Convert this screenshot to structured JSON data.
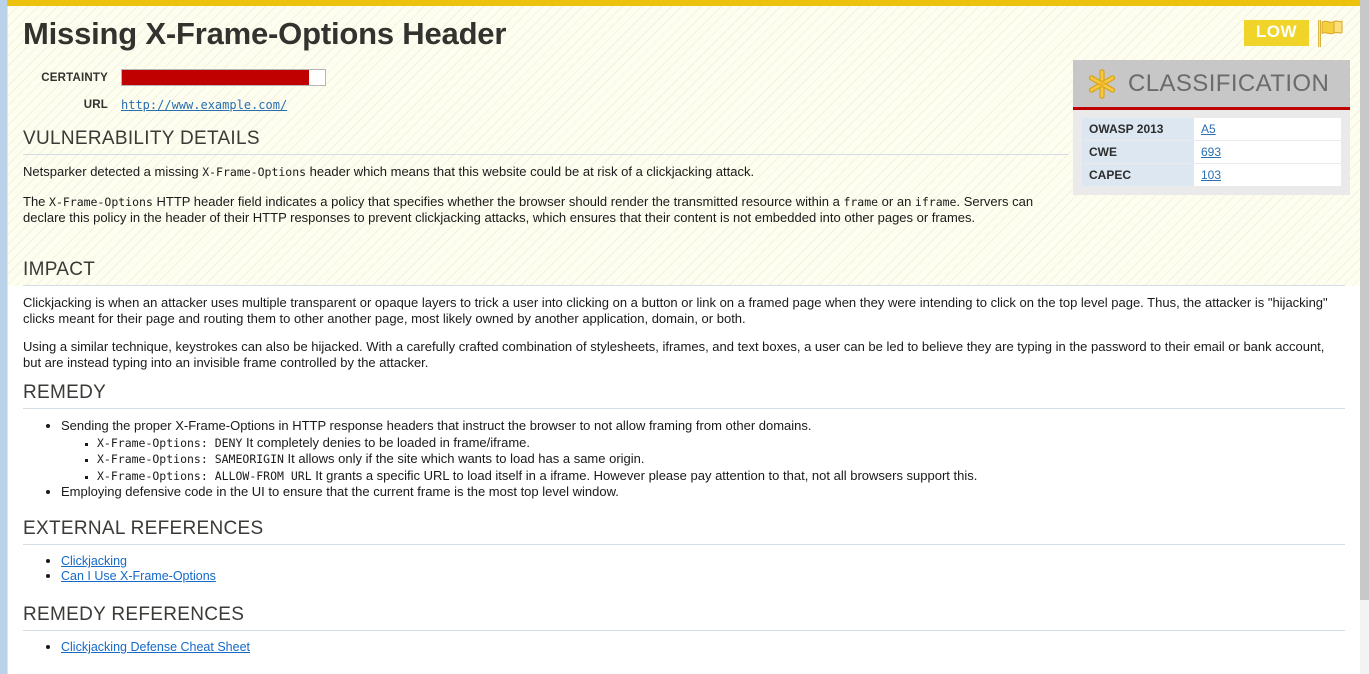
{
  "report": {
    "title": "Missing X-Frame-Options Header",
    "severity_badge": "LOW",
    "severity_color": "#f0d429",
    "flag_icon": "flag-icon"
  },
  "meta": {
    "certainty_label": "CERTAINTY",
    "certainty_percent": 92,
    "certainty_bar_color": "#c00000",
    "url_label": "URL",
    "url_value": "http://www.example.com/"
  },
  "classification": {
    "icon": "asterisk-star-icon",
    "heading": "CLASSIFICATION",
    "accent_color": "#c00000",
    "rows": [
      {
        "key": "OWASP 2013",
        "value": "A5"
      },
      {
        "key": "CWE",
        "value": "693"
      },
      {
        "key": "CAPEC",
        "value": "103"
      }
    ]
  },
  "sections": {
    "vulnerability_details": {
      "heading": "VULNERABILITY DETAILS",
      "p1_a": "Netsparker detected a missing ",
      "p1_code": "X-Frame-Options",
      "p1_b": " header which means that this website could be at risk of a clickjacking attack.",
      "p2_a": "The ",
      "p2_code1": "X-Frame-Options",
      "p2_b": " HTTP header field indicates a policy that specifies whether the browser should render the transmitted resource within a ",
      "p2_code2": "frame",
      "p2_c": " or an ",
      "p2_code3": "iframe",
      "p2_d": ". Servers can declare this policy in the header of their HTTP responses to prevent clickjacking attacks, which ensures that their content is not embedded into other pages or frames."
    },
    "impact": {
      "heading": "IMPACT",
      "p1": "Clickjacking is when an attacker uses multiple transparent or opaque layers to trick a user into clicking on a button or link on a framed page when they were intending to click on the top level page. Thus, the attacker is \"hijacking\" clicks meant for their page and routing them to other another page, most likely owned by another application, domain, or both.",
      "p2": "Using a similar technique, keystrokes can also be hijacked. With a carefully crafted combination of stylesheets, iframes, and text boxes, a user can be led to believe they are typing in the password to their email or bank account, but are instead typing into an invisible frame controlled by the attacker."
    },
    "remedy": {
      "heading": "REMEDY",
      "bullet1": "Sending the proper X-Frame-Options in HTTP response headers that instruct the browser to not allow framing from other domains.",
      "sub1_code": "X-Frame-Options: DENY",
      "sub1_text": " It completely denies to be loaded in frame/iframe.",
      "sub2_code": "X-Frame-Options: SAMEORIGIN",
      "sub2_text": " It allows only if the site which wants to load has a same origin.",
      "sub3_code": "X-Frame-Options: ALLOW-FROM URL",
      "sub3_text": " It grants a specific URL to load itself in a iframe. However please pay attention to that, not all browsers support this.",
      "bullet2": "Employing defensive code in the UI to ensure that the current frame is the most top level window."
    },
    "external_references": {
      "heading": "EXTERNAL REFERENCES",
      "links": [
        "Clickjacking",
        "Can I Use X-Frame-Options"
      ]
    },
    "remedy_references": {
      "heading": "REMEDY REFERENCES",
      "links": [
        "Clickjacking Defense Cheat Sheet"
      ]
    }
  }
}
